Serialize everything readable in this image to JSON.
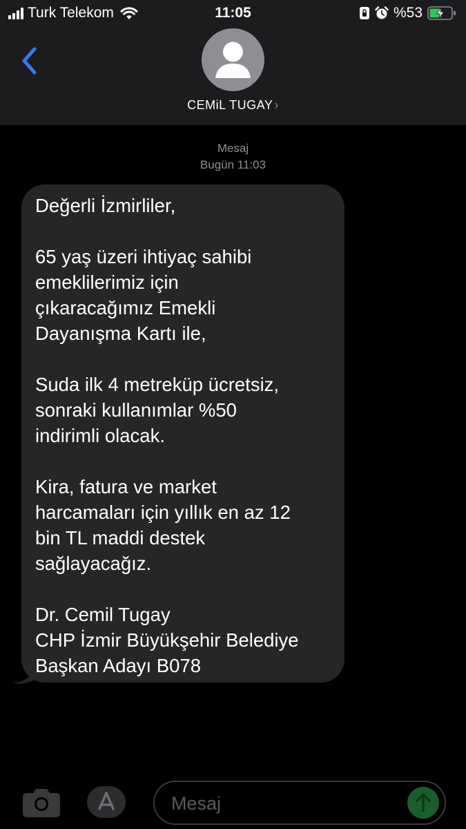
{
  "status_bar": {
    "carrier": "Turk Telekom",
    "time": "11:05",
    "battery": "%53"
  },
  "header": {
    "contact_name": "CEMiL TUGAY",
    "chevron": "›"
  },
  "thread": {
    "service": "Mesaj",
    "timestamp": "Bugün 11:03"
  },
  "message": {
    "text": "Değerli İzmirliler,\n\n65 yaş üzeri ihtiyaç sahibi\nemeklilerimiz için\nçıkaracağımız Emekli\nDayanışma Kartı ile,\n\nSuda ilk 4 metreküp ücretsiz,\nsonraki kullanımlar %50\nindirimli olacak.\n\nKira, fatura ve market\nharcamaları için yıllık en az 12\nbin TL maddi destek\nsağlayacağız.\n\nDr. Cemil Tugay\nCHP İzmir Büyükşehir Belediye\nBaşkan Adayı B078"
  },
  "composer": {
    "placeholder": "Mesaj"
  },
  "colors": {
    "header_bg": "#1c1c1e",
    "bubble_bg": "#262629",
    "accent_blue": "#2f7cf6",
    "send_green": "#1a5e2c",
    "battery_green": "#34c759"
  },
  "icons": [
    "signal-icon",
    "wifi-icon",
    "lock-rotation-icon",
    "alarm-icon",
    "battery-charging-icon",
    "back-chevron-icon",
    "contact-avatar-icon",
    "camera-icon",
    "app-store-icon",
    "send-arrow-icon"
  ]
}
